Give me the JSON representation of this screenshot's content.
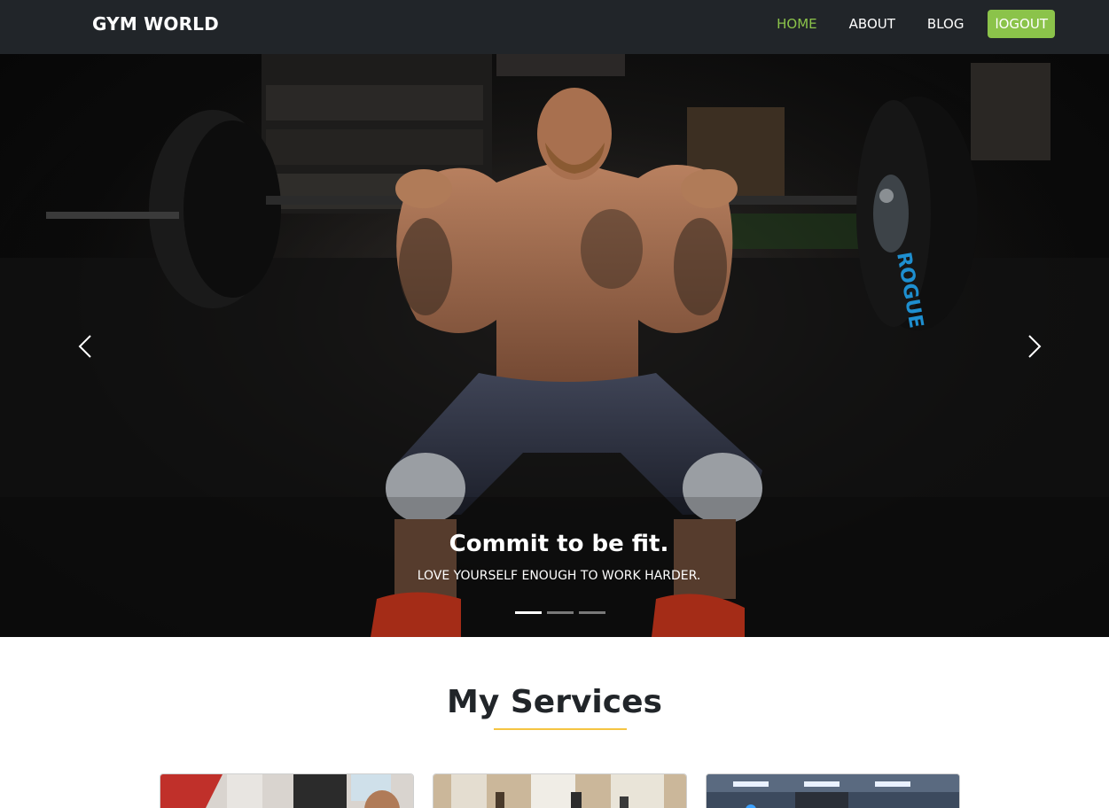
{
  "navbar": {
    "brand": "GYM WORLD",
    "links": [
      {
        "label": "HOME",
        "active": true
      },
      {
        "label": "ABOUT",
        "active": false
      },
      {
        "label": "BLOG",
        "active": false
      },
      {
        "label": "lOGOUT",
        "active": false
      }
    ]
  },
  "carousel": {
    "image_description_icon": "weightlifter-photo",
    "caption_title": "Commit to be fit.",
    "caption_text": "LOVE YOURSELF ENOUGH TO WORK HARDER.",
    "slide_count": 3,
    "active_slide": 1,
    "prev_icon": "chevron-left-icon",
    "next_icon": "chevron-right-icon",
    "plate_lettering": "ROGUE"
  },
  "services": {
    "title": "My Services",
    "cards": [
      {
        "image_icon": "gym-service-photo-1"
      },
      {
        "image_icon": "gym-service-photo-2"
      },
      {
        "image_icon": "gym-service-photo-3"
      }
    ]
  },
  "colors": {
    "navbar_bg": "#212529",
    "accent_green": "#8bc34a",
    "title_underline": "#f5c542",
    "title_text": "#212529"
  }
}
